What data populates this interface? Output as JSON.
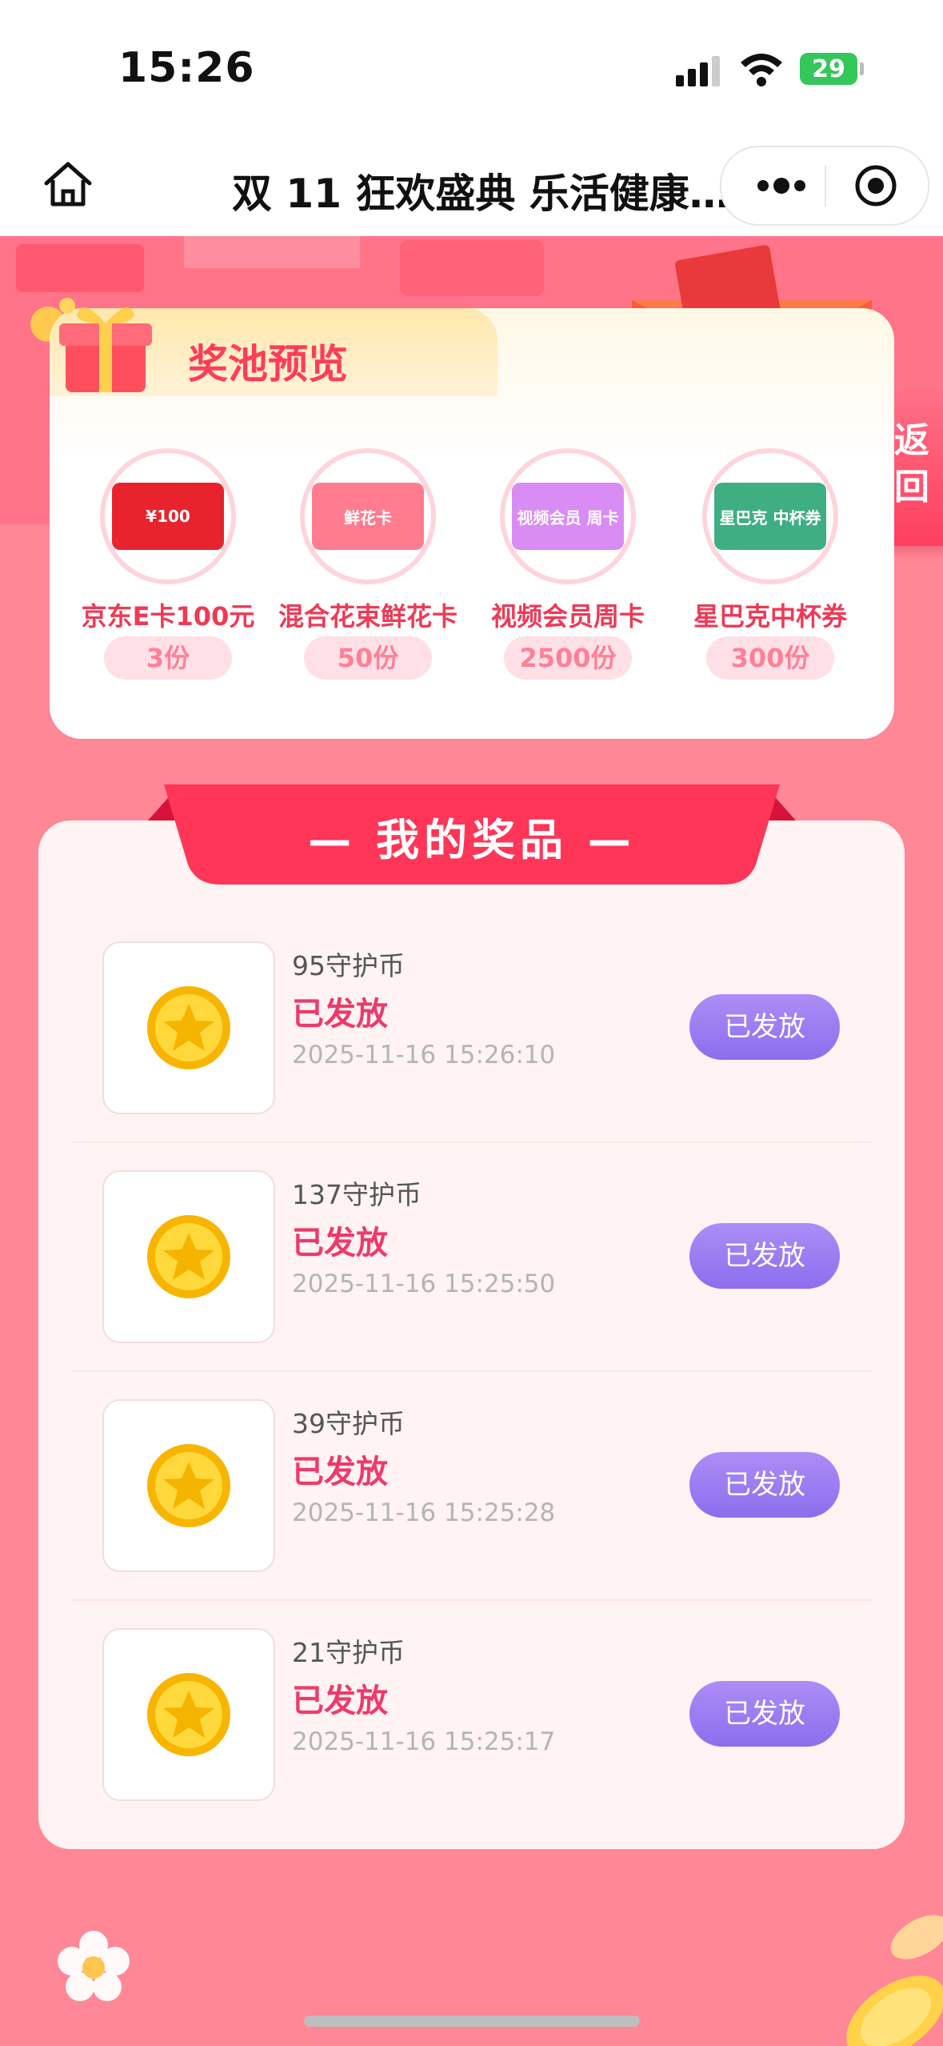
{
  "status_bar": {
    "time": "15:26",
    "battery": "29"
  },
  "nav": {
    "title": "双 11 狂欢盛典 乐活健康…"
  },
  "pool": {
    "title": "奖池预览",
    "items": [
      {
        "name": "京东E卡100元",
        "qty": "3份",
        "card_label": "¥100"
      },
      {
        "name": "混合花束鲜花卡",
        "qty": "50份",
        "card_label": "鲜花卡"
      },
      {
        "name": "视频会员周卡",
        "qty": "2500份",
        "card_label": "视频会员 周卡"
      },
      {
        "name": "星巴克中杯券",
        "qty": "300份",
        "card_label": "星巴克 中杯券"
      }
    ]
  },
  "side_button": {
    "label": "返回"
  },
  "my_prizes": {
    "title": "— 我的奖品 —",
    "rows": [
      {
        "name": "95守护币",
        "status": "已发放",
        "time": "2025-11-16 15:26:10",
        "button": "已发放"
      },
      {
        "name": "137守护币",
        "status": "已发放",
        "time": "2025-11-16 15:25:50",
        "button": "已发放"
      },
      {
        "name": "39守护币",
        "status": "已发放",
        "time": "2025-11-16 15:25:28",
        "button": "已发放"
      },
      {
        "name": "21守护币",
        "status": "已发放",
        "time": "2025-11-16 15:25:17",
        "button": "已发放"
      }
    ]
  },
  "colors": {
    "accent": "#ee3a55",
    "button": "#8c6eee",
    "background": "#ff8796"
  }
}
